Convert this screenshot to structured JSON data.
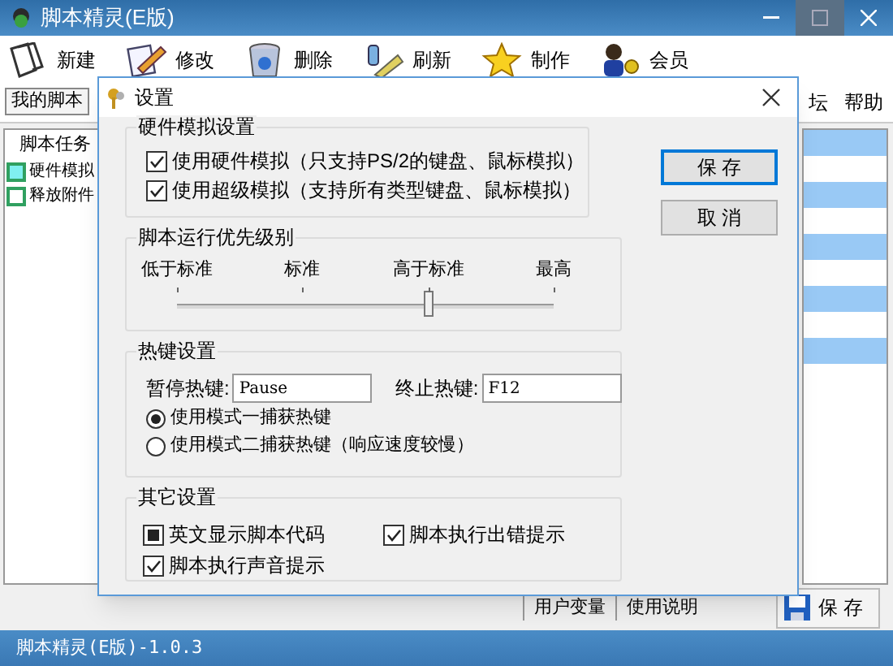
{
  "window": {
    "title": "脚本精灵(E版)"
  },
  "toolbar": [
    {
      "label": "新建",
      "kind": "new"
    },
    {
      "label": "修改",
      "kind": "edit"
    },
    {
      "label": "删除",
      "kind": "delete"
    },
    {
      "label": "刷新",
      "kind": "refresh"
    },
    {
      "label": "制作",
      "kind": "star"
    },
    {
      "label": "会员",
      "kind": "member"
    }
  ],
  "script_tab": "我的脚本",
  "menu": [
    "坛",
    "帮助"
  ],
  "task_list": {
    "header": "脚本任务",
    "items": [
      {
        "label": "硬件模拟",
        "selected": true
      },
      {
        "label": "释放附件",
        "selected": false
      }
    ]
  },
  "bottom_tabs": [
    "用户变量",
    "使用说明"
  ],
  "save_button": "保 存",
  "status_bar": "脚本精灵(E版)-1.0.3",
  "dialog": {
    "title": "设置",
    "hardware": {
      "title": "硬件模拟设置",
      "options": [
        {
          "label": "使用硬件模拟（只支持PS/2的键盘、鼠标模拟）",
          "checked": true
        },
        {
          "label": "使用超级模拟（支持所有类型键盘、鼠标模拟）",
          "checked": true
        }
      ]
    },
    "priority": {
      "title": "脚本运行优先级别",
      "labels": [
        "低于标准",
        "标准",
        "高于标准",
        "最高"
      ],
      "level": 0.667
    },
    "hotkeys": {
      "title": "热键设置",
      "pause_label": "暂停热键:",
      "pause_value": "Pause",
      "stop_label": "终止热键:",
      "stop_value": "F12",
      "modes": [
        {
          "label": "使用模式一捕获热键",
          "selected": true
        },
        {
          "label": "使用模式二捕获热键（响应速度较慢）",
          "selected": false
        }
      ]
    },
    "other": {
      "title": "其它设置",
      "options": [
        {
          "label": "英文显示脚本代码",
          "checked": true,
          "kind": "square"
        },
        {
          "label": "脚本执行出错提示",
          "checked": true,
          "kind": "tick"
        },
        {
          "label": "脚本执行声音提示",
          "checked": true,
          "kind": "tick"
        }
      ]
    },
    "buttons": [
      {
        "label": "保 存",
        "default": true
      },
      {
        "label": "取 消",
        "default": false
      }
    ]
  }
}
